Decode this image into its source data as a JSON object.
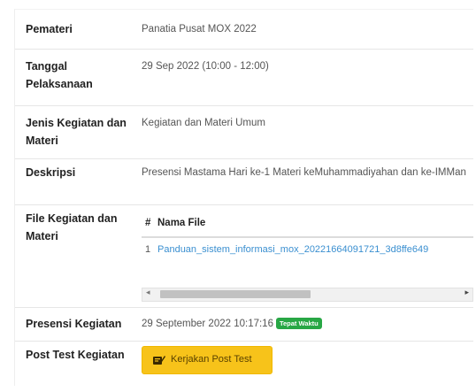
{
  "details": {
    "pemateri": {
      "label": "Pemateri",
      "value": "Panatia Pusat MOX 2022"
    },
    "tanggal": {
      "label": "Tanggal Pelaksanaan",
      "value": "29 Sep 2022 (10:00 - 12:00)"
    },
    "jenis": {
      "label": "Jenis Kegiatan dan Materi",
      "value": "Kegiatan dan Materi Umum"
    },
    "deskripsi": {
      "label": "Deskripsi",
      "value": "Presensi Mastama Hari ke-1 Materi keMuhammadiyahan dan ke-IMMan"
    },
    "file": {
      "label": "File Kegiatan dan Materi",
      "col_num": "#",
      "col_name": "Nama File",
      "rows": [
        {
          "num": "1",
          "name": "Panduan_sistem_informasi_mox_20221664091721_3d8ffe649"
        }
      ],
      "scroll_left": "◂",
      "scroll_right": "▸"
    },
    "presensi": {
      "label": "Presensi Kegiatan",
      "value": "29 September 2022 10:17:16",
      "badge": "Tepat Waktu"
    },
    "post_test": {
      "label": "Post Test Kegiatan",
      "button": "Kerjakan Post Test"
    }
  },
  "colors": {
    "link": "#3a8fd0",
    "badge": "#28a745",
    "button": "#f7c31a"
  },
  "icons": {
    "post_test_button": "edit-icon"
  }
}
